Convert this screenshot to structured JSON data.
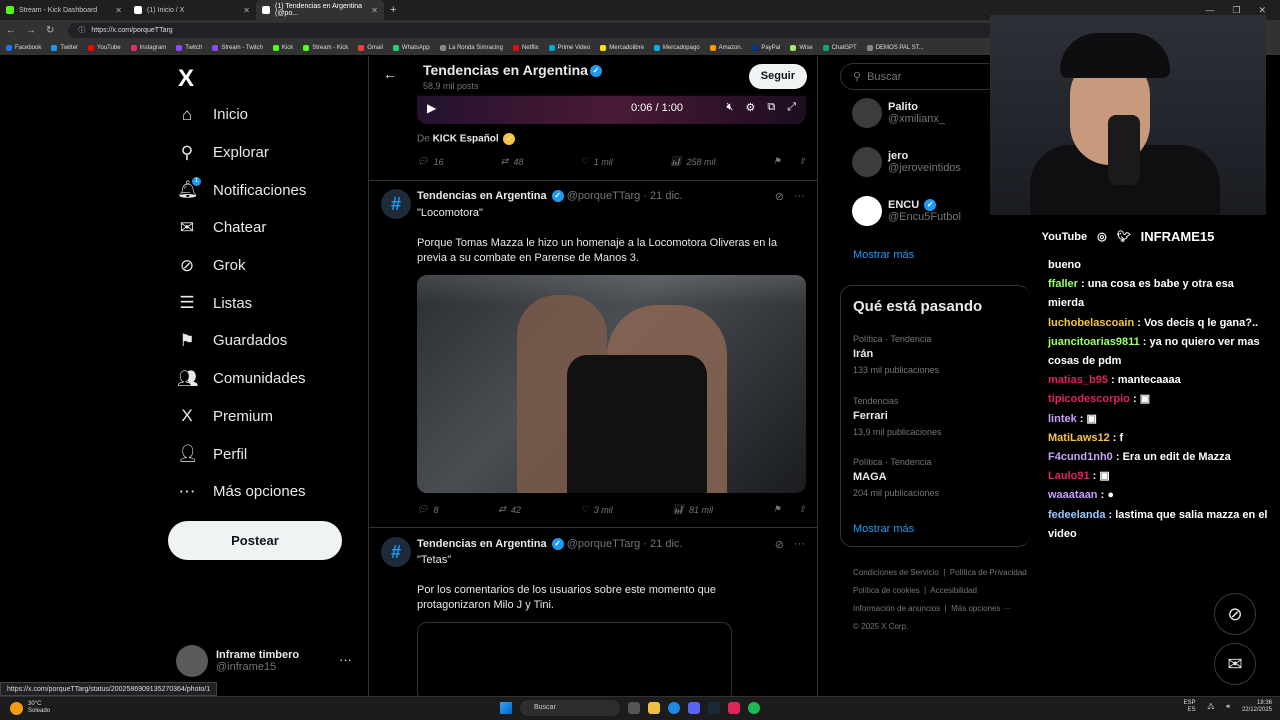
{
  "browser": {
    "tabs": [
      {
        "label": "Stream - Kick Dashboard",
        "color": "#53fc18"
      },
      {
        "label": "(1) Inicio / X",
        "color": "#000000"
      },
      {
        "label": "(1) Tendencias en Argentina (@po...",
        "color": "#000000"
      }
    ],
    "url": "https://x.com/porqueTTarg",
    "bookmarks": [
      "Facebook",
      "Twitter",
      "YouTube",
      "Instagram",
      "Twitch",
      "Stream - Twitch",
      "Kick",
      "Stream - Kick",
      "Gmail",
      "WhatsApp",
      "La Ronda Simracing",
      "Netflix",
      "Prime Video",
      "Mercadolibre",
      "Mercadopago",
      "Amazon.",
      "PayPal",
      "Wise",
      "ChatGPT",
      "DEMOS PAL ST..."
    ],
    "status_url": "https://x.com/porqueTTarg/status/2002586909135270364/photo/1"
  },
  "sidebar": {
    "logo": "X",
    "items": [
      {
        "label": "Inicio",
        "icon": "home-icon",
        "glyph": "⌂"
      },
      {
        "label": "Explorar",
        "icon": "search-icon",
        "glyph": "⚲"
      },
      {
        "label": "Notificaciones",
        "icon": "bell-icon",
        "glyph": "🔔︎",
        "badge": "1"
      },
      {
        "label": "Chatear",
        "icon": "mail-icon",
        "glyph": "✉"
      },
      {
        "label": "Grok",
        "icon": "grok-icon",
        "glyph": "⊘"
      },
      {
        "label": "Listas",
        "icon": "list-icon",
        "glyph": "☰"
      },
      {
        "label": "Guardados",
        "icon": "bookmark-icon",
        "glyph": "⚑"
      },
      {
        "label": "Comunidades",
        "icon": "communities-icon",
        "glyph": "👥︎"
      },
      {
        "label": "Premium",
        "icon": "x-premium-icon",
        "glyph": "X"
      },
      {
        "label": "Perfil",
        "icon": "profile-icon",
        "glyph": "👤︎"
      },
      {
        "label": "Más opciones",
        "icon": "more-options-icon",
        "glyph": "⋯"
      }
    ],
    "post_label": "Postear",
    "account": {
      "name": "Inframe timbero",
      "handle": "@inframe15"
    }
  },
  "header": {
    "title": "Tendencias en Argentina",
    "subtitle": "58,9 mil posts",
    "follow_label": "Seguir"
  },
  "video": {
    "time": "0:06 / 1:00"
  },
  "tweet0": {
    "source_prefix": "De",
    "source_name": "KICK Español",
    "replies": "16",
    "reposts": "48",
    "likes": "1 mil",
    "views": "258 mil"
  },
  "tweet1": {
    "name": "Tendencias en Argentina",
    "handle": "@porqueTTarg · 21 dic.",
    "quote": "\"Locomotora\"",
    "text": "Porque Tomas Mazza le hizo un homenaje a la Locomotora Oliveras en la previa a su combate en Parense de Manos 3.",
    "replies": "8",
    "reposts": "42",
    "likes": "3 mil",
    "views": "81 mil"
  },
  "tweet2": {
    "name": "Tendencias en Argentina",
    "handle": "@porqueTTarg · 21 dic.",
    "quote": "\"Tetas\"",
    "text": "Por los comentarios de los usuarios sobre este momento que protagonizaron Milo J y Tini."
  },
  "right": {
    "search_placeholder": "Buscar",
    "who": [
      {
        "name": "Palito",
        "handle": "@xmilianx_"
      },
      {
        "name": "jero",
        "handle": "@jeroveintidos"
      },
      {
        "name": "ENCU",
        "handle": "@Encu5Futbol"
      }
    ],
    "show_more": "Mostrar más",
    "trends_title": "Qué está pasando",
    "trends": [
      {
        "context": "Política · Tendencia",
        "topic": "Irán",
        "posts": "133 mil publicaciones"
      },
      {
        "context": "Tendencias",
        "topic": "Ferrari",
        "posts": "13,9 mil publicaciones"
      },
      {
        "context": "Política · Tendencia",
        "topic": "MAGA",
        "posts": "204 mil publicaciones"
      }
    ],
    "trends_more": "Mostrar más",
    "footer": [
      "Condiciones de Servicio",
      "Política de Privacidad",
      "Política de cookies",
      "Accesibilidad",
      "Información de anuncios",
      "Más opciones ···",
      "© 2025 X Corp."
    ]
  },
  "overlay": {
    "socials": [
      "YouTube",
      "INFRAME15"
    ],
    "chat": [
      {
        "user": "",
        "msg": "bueno",
        "color": "#ffffff"
      },
      {
        "user": "ffaller",
        "msg": "una cosa es babe y otra esa mierda",
        "color": "#9cff6b"
      },
      {
        "user": "luchobelascoain",
        "msg": "Vos decis q le gana?..",
        "color": "#f6c343"
      },
      {
        "user": "juancitoarias9811",
        "msg": "ya no quiero ver mas cosas de pdm",
        "color": "#9cff6b"
      },
      {
        "user": "matias_b95",
        "msg": "mantecaaaa",
        "color": "#e0245e"
      },
      {
        "user": "tipicodescorpio",
        "msg": "▣",
        "color": "#e0245e"
      },
      {
        "user": "lintek",
        "msg": "▣",
        "color": "#c9a0ff"
      },
      {
        "user": "MatiLaws12",
        "msg": "f",
        "color": "#f6c343"
      },
      {
        "user": "F4cund1nh0",
        "msg": "Era un edit de Mazza",
        "color": "#c9a0ff"
      },
      {
        "user": "Laulo91",
        "msg": "▣",
        "color": "#e0245e"
      },
      {
        "user": "waaataan",
        "msg": "●",
        "color": "#c9a0ff"
      },
      {
        "user": "fedeelanda",
        "msg": "lastima que salia mazza en el video",
        "color": "#9cc8ff"
      }
    ]
  },
  "taskbar": {
    "weather_temp": "30°C",
    "weather_desc": "Soleado",
    "search_label": "Buscar",
    "lang": "ESP",
    "lang_sub": "ES",
    "time": "18:36",
    "date": "22/12/2025"
  }
}
